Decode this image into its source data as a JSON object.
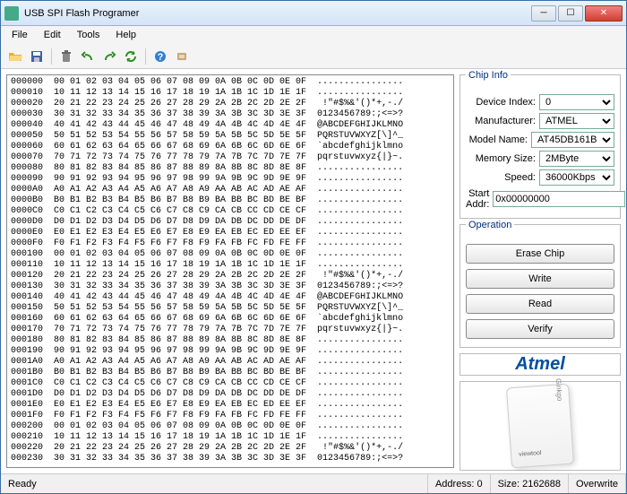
{
  "window": {
    "title": "USB SPI Flash Programer"
  },
  "menu": {
    "file": "File",
    "edit": "Edit",
    "tools": "Tools",
    "help": "Help"
  },
  "chipinfo": {
    "title": "Chip Info",
    "device_index_label": "Device Index:",
    "device_index": "0",
    "manufacturer_label": "Manufacturer:",
    "manufacturer": "ATMEL",
    "model_label": "Model Name:",
    "model": "AT45DB161B",
    "memory_label": "Memory Size:",
    "memory": "2MByte",
    "speed_label": "Speed:",
    "speed": "36000Kbps",
    "startaddr_label": "Start Addr:",
    "startaddr": "0x00000000"
  },
  "operation": {
    "title": "Operation",
    "erase": "Erase Chip",
    "write": "Write",
    "read": "Read",
    "verify": "Verify"
  },
  "logo": {
    "text": "Atmel"
  },
  "device_img": {
    "brand": "Ginkgo",
    "sub": "viewtool"
  },
  "status": {
    "ready": "Ready",
    "addr_label": "Address:",
    "addr": "0",
    "size_label": "Size:",
    "size": "2162688",
    "mode": "Overwrite"
  },
  "hex": {
    "addrs": [
      "000000",
      "000010",
      "000020",
      "000030",
      "000040",
      "000050",
      "000060",
      "000070",
      "000080",
      "000090",
      "0000A0",
      "0000B0",
      "0000C0",
      "0000D0",
      "0000E0",
      "0000F0",
      "000100",
      "000110",
      "000120",
      "000130",
      "000140",
      "000150",
      "000160",
      "000170",
      "000180",
      "000190",
      "0001A0",
      "0001B0",
      "0001C0",
      "0001D0",
      "0001E0",
      "0001F0",
      "000200",
      "000210",
      "000220",
      "000230"
    ],
    "bytes": [
      "00 01 02 03 04 05 06 07 08 09 0A 0B 0C 0D 0E 0F",
      "10 11 12 13 14 15 16 17 18 19 1A 1B 1C 1D 1E 1F",
      "20 21 22 23 24 25 26 27 28 29 2A 2B 2C 2D 2E 2F",
      "30 31 32 33 34 35 36 37 38 39 3A 3B 3C 3D 3E 3F",
      "40 41 42 43 44 45 46 47 48 49 4A 4B 4C 4D 4E 4F",
      "50 51 52 53 54 55 56 57 58 59 5A 5B 5C 5D 5E 5F",
      "60 61 62 63 64 65 66 67 68 69 6A 6B 6C 6D 6E 6F",
      "70 71 72 73 74 75 76 77 78 79 7A 7B 7C 7D 7E 7F",
      "80 81 82 83 84 85 86 87 88 89 8A 8B 8C 8D 8E 8F",
      "90 91 92 93 94 95 96 97 98 99 9A 9B 9C 9D 9E 9F",
      "A0 A1 A2 A3 A4 A5 A6 A7 A8 A9 AA AB AC AD AE AF",
      "B0 B1 B2 B3 B4 B5 B6 B7 B8 B9 BA BB BC BD BE BF",
      "C0 C1 C2 C3 C4 C5 C6 C7 C8 C9 CA CB CC CD CE CF",
      "D0 D1 D2 D3 D4 D5 D6 D7 D8 D9 DA DB DC DD DE DF",
      "E0 E1 E2 E3 E4 E5 E6 E7 E8 E9 EA EB EC ED EE EF",
      "F0 F1 F2 F3 F4 F5 F6 F7 F8 F9 FA FB FC FD FE FF",
      "00 01 02 03 04 05 06 07 08 09 0A 0B 0C 0D 0E 0F",
      "10 11 12 13 14 15 16 17 18 19 1A 1B 1C 1D 1E 1F",
      "20 21 22 23 24 25 26 27 28 29 2A 2B 2C 2D 2E 2F",
      "30 31 32 33 34 35 36 37 38 39 3A 3B 3C 3D 3E 3F",
      "40 41 42 43 44 45 46 47 48 49 4A 4B 4C 4D 4E 4F",
      "50 51 52 53 54 55 56 57 58 59 5A 5B 5C 5D 5E 5F",
      "60 61 62 63 64 65 66 67 68 69 6A 6B 6C 6D 6E 6F",
      "70 71 72 73 74 75 76 77 78 79 7A 7B 7C 7D 7E 7F",
      "80 81 82 83 84 85 86 87 88 89 8A 8B 8C 8D 8E 8F",
      "90 91 92 93 94 95 96 97 98 99 9A 9B 9C 9D 9E 9F",
      "A0 A1 A2 A3 A4 A5 A6 A7 A8 A9 AA AB AC AD AE AF",
      "B0 B1 B2 B3 B4 B5 B6 B7 B8 B9 BA BB BC BD BE BF",
      "C0 C1 C2 C3 C4 C5 C6 C7 C8 C9 CA CB CC CD CE CF",
      "D0 D1 D2 D3 D4 D5 D6 D7 D8 D9 DA DB DC DD DE DF",
      "E0 E1 E2 E3 E4 E5 E6 E7 E8 E9 EA EB EC ED EE EF",
      "F0 F1 F2 F3 F4 F5 F6 F7 F8 F9 FA FB FC FD FE FF",
      "00 01 02 03 04 05 06 07 08 09 0A 0B 0C 0D 0E 0F",
      "10 11 12 13 14 15 16 17 18 19 1A 1B 1C 1D 1E 1F",
      "20 21 22 23 24 25 26 27 28 29 2A 2B 2C 2D 2E 2F",
      "30 31 32 33 34 35 36 37 38 39 3A 3B 3C 3D 3E 3F"
    ],
    "ascii": [
      "................",
      "................",
      " !\"#$%&'()*+,-./",
      "0123456789:;<=>?",
      "@ABCDEFGHIJKLMNO",
      "PQRSTUVWXYZ[\\]^_",
      "`abcdefghijklmno",
      "pqrstuvwxyz{|}~.",
      "................",
      "................",
      "................",
      "................",
      "................",
      "................",
      "................",
      "................",
      "................",
      "................",
      " !\"#$%&'()*+,-./",
      "0123456789:;<=>?",
      "@ABCDEFGHIJKLMNO",
      "PQRSTUVWXYZ[\\]^_",
      "`abcdefghijklmno",
      "pqrstuvwxyz{|}~.",
      "................",
      "................",
      "................",
      "................",
      "................",
      "................",
      "................",
      "................",
      "................",
      "................",
      " !\"#$%&'()*+,-./",
      "0123456789:;<=>?"
    ]
  }
}
